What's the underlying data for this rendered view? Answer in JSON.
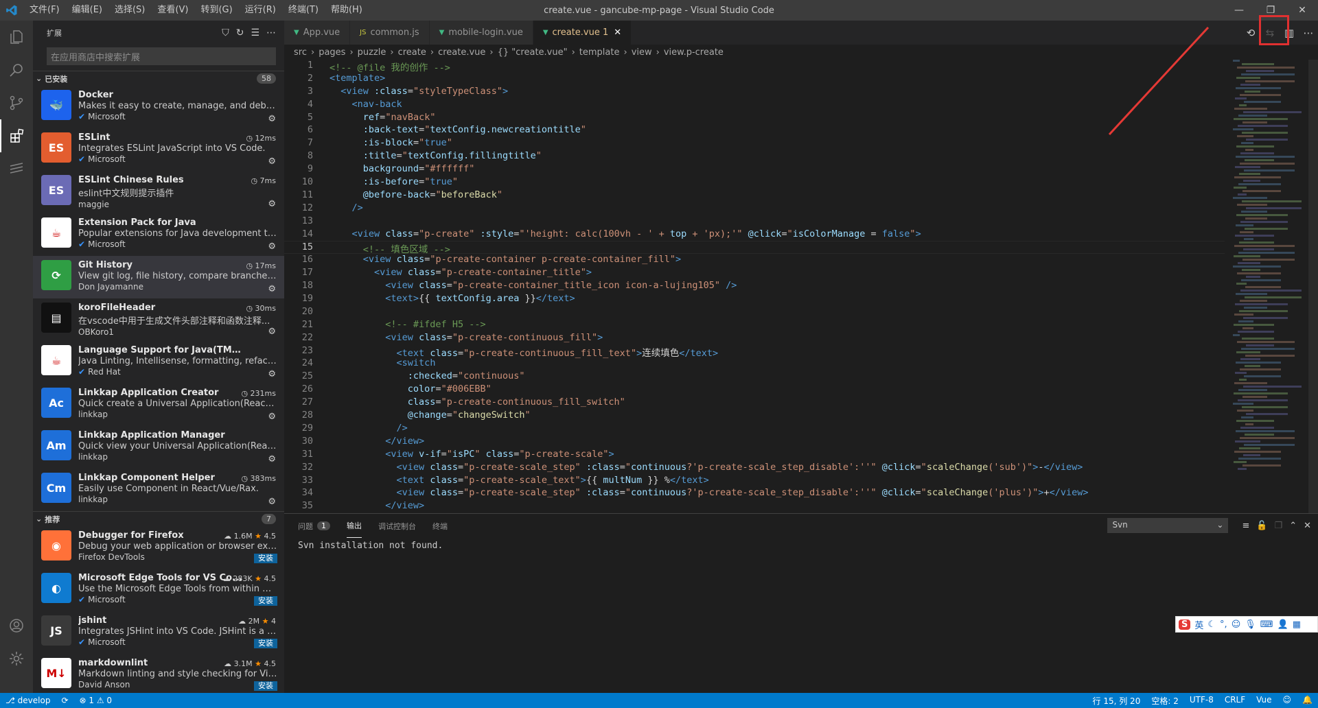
{
  "window": {
    "title": "create.vue - gancube-mp-page - Visual Studio Code",
    "menu": [
      "文件(F)",
      "编辑(E)",
      "选择(S)",
      "查看(V)",
      "转到(G)",
      "运行(R)",
      "终端(T)",
      "帮助(H)"
    ]
  },
  "sidebar": {
    "title": "扩展",
    "search_placeholder": "在应用商店中搜索扩展",
    "installed": {
      "label": "已安装",
      "count": "58",
      "items": [
        {
          "name": "Docker",
          "desc": "Makes it easy to create, manage, and debug co...",
          "publisher": "Microsoft",
          "verified": true,
          "time": "",
          "icon": "docker-icon",
          "color": "#1d63ed",
          "glyph": "🐳"
        },
        {
          "name": "ESLint",
          "desc": "Integrates ESLint JavaScript into VS Code.",
          "publisher": "Microsoft",
          "verified": true,
          "time": "12ms",
          "icon": "eslint-icon",
          "color": "#e35d2f",
          "glyph": "ES"
        },
        {
          "name": "ESLint Chinese Rules",
          "desc": "eslint中文规则提示插件",
          "publisher": "maggie",
          "verified": false,
          "time": "7ms",
          "icon": "eslint-chinese-icon",
          "color": "#6b6bb5",
          "glyph": "ES"
        },
        {
          "name": "Extension Pack for Java",
          "desc": "Popular extensions for Java development that p...",
          "publisher": "Microsoft",
          "verified": true,
          "time": "",
          "icon": "java-pack-icon",
          "color": "#ffffff",
          "glyph": "☕"
        },
        {
          "name": "Git History",
          "desc": "View git log, file history, compare branches or c...",
          "publisher": "Don Jayamanne",
          "verified": false,
          "time": "17ms",
          "icon": "git-history-icon",
          "color": "#2f9e44",
          "glyph": "⟳"
        },
        {
          "name": "koroFileHeader",
          "desc": "在vscode中用于生成文件头部注释和函数注释...",
          "publisher": "OBKoro1",
          "verified": false,
          "time": "30ms",
          "icon": "korofileheader-icon",
          "color": "#111111",
          "glyph": "▤"
        },
        {
          "name": "Language Support for Java(TM) by Red Hat",
          "desc": "Java Linting, Intellisense, formatting, refactoring...",
          "publisher": "Red Hat",
          "verified": true,
          "time": "",
          "icon": "redhat-java-icon",
          "color": "#ffffff",
          "glyph": "☕"
        },
        {
          "name": "Linkkap Application Creator",
          "desc": "Quick create a Universal Application(React/Rax/...",
          "publisher": "linkkap",
          "verified": false,
          "time": "231ms",
          "icon": "linkkap-creator-icon",
          "color": "#1e6fd9",
          "glyph": "Ac"
        },
        {
          "name": "Linkkap Application Manager",
          "desc": "Quick view your Universal Application(React/Ra...",
          "publisher": "linkkap",
          "verified": false,
          "time": "",
          "icon": "linkkap-manager-icon",
          "color": "#1e6fd9",
          "glyph": "Am"
        },
        {
          "name": "Linkkap Component Helper",
          "desc": "Easily use Component in React/Vue/Rax.",
          "publisher": "linkkap",
          "verified": false,
          "time": "383ms",
          "icon": "linkkap-helper-icon",
          "color": "#1e6fd9",
          "glyph": "Cm"
        }
      ]
    },
    "recommended": {
      "label": "推荐",
      "count": "7",
      "items": [
        {
          "name": "Debugger for Firefox",
          "desc": "Debug your web application or browser extensi...",
          "publisher": "Firefox DevTools",
          "verified": false,
          "downloads": "1.6M",
          "rating": "4.5",
          "install": "安装",
          "icon": "firefox-icon",
          "color": "#ff7139",
          "glyph": "◉"
        },
        {
          "name": "Microsoft Edge Tools for VS Co...",
          "desc": "Use the Microsoft Edge Tools from within VS C...",
          "publisher": "Microsoft",
          "verified": true,
          "downloads": "283K",
          "rating": "4.5",
          "install": "安装",
          "icon": "edge-icon",
          "color": "#0f7bd0",
          "glyph": "◐"
        },
        {
          "name": "jshint",
          "desc": "Integrates JSHint into VS Code. JSHint is a linter...",
          "publisher": "Microsoft",
          "verified": true,
          "downloads": "2M",
          "rating": "4",
          "install": "安装",
          "icon": "jshint-icon",
          "color": "#3a3a3a",
          "glyph": "JS"
        },
        {
          "name": "markdownlint",
          "desc": "Markdown linting and style checking for Visual ...",
          "publisher": "David Anson",
          "verified": false,
          "downloads": "3.1M",
          "rating": "4.5",
          "install": "安装",
          "icon": "markdownlint-icon",
          "color": "#ffffff",
          "glyph": "M↓"
        }
      ]
    }
  },
  "editor": {
    "tabs": [
      {
        "label": "App.vue",
        "icon": "vue-icon",
        "active": false
      },
      {
        "label": "common.js",
        "icon": "js-icon",
        "active": false
      },
      {
        "label": "mobile-login.vue",
        "icon": "vue-icon",
        "active": false
      },
      {
        "label": "create.vue 1",
        "icon": "vue-icon",
        "active": true
      }
    ],
    "breadcrumb": [
      "src",
      "pages",
      "puzzle",
      "create",
      "create.vue",
      "{} \"create.vue\"",
      "template",
      "view",
      "view.p-create"
    ],
    "current_line": 15,
    "lines": [
      [
        [
          "c-cm",
          "<!-- @file 我的创作 -->"
        ]
      ],
      [
        [
          "c-tag",
          "<template>"
        ]
      ],
      [
        [
          "c-txt",
          "  "
        ],
        [
          "c-tag",
          "<view "
        ],
        [
          "c-at",
          ":class"
        ],
        [
          "c-txt",
          "="
        ],
        [
          "c-str",
          "\"styleTypeClass\""
        ],
        [
          "c-tag",
          ">"
        ]
      ],
      [
        [
          "c-txt",
          "    "
        ],
        [
          "c-tag",
          "<nav-back"
        ]
      ],
      [
        [
          "c-txt",
          "      "
        ],
        [
          "c-at",
          "ref"
        ],
        [
          "c-txt",
          "="
        ],
        [
          "c-str",
          "\"navBack\""
        ]
      ],
      [
        [
          "c-txt",
          "      "
        ],
        [
          "c-at",
          ":back-text"
        ],
        [
          "c-txt",
          "="
        ],
        [
          "c-str",
          "\""
        ],
        [
          "c-at",
          "textConfig.newcreationtitle"
        ],
        [
          "c-str",
          "\""
        ]
      ],
      [
        [
          "c-txt",
          "      "
        ],
        [
          "c-at",
          ":is-block"
        ],
        [
          "c-txt",
          "="
        ],
        [
          "c-str",
          "\""
        ],
        [
          "c-tag",
          "true"
        ],
        [
          "c-str",
          "\""
        ]
      ],
      [
        [
          "c-txt",
          "      "
        ],
        [
          "c-at",
          ":title"
        ],
        [
          "c-txt",
          "="
        ],
        [
          "c-str",
          "\""
        ],
        [
          "c-at",
          "textConfig.fillingtitle"
        ],
        [
          "c-str",
          "\""
        ]
      ],
      [
        [
          "c-txt",
          "      "
        ],
        [
          "c-at",
          "background"
        ],
        [
          "c-txt",
          "="
        ],
        [
          "c-str",
          "\"#ffffff\""
        ]
      ],
      [
        [
          "c-txt",
          "      "
        ],
        [
          "c-at",
          ":is-before"
        ],
        [
          "c-txt",
          "="
        ],
        [
          "c-str",
          "\""
        ],
        [
          "c-tag",
          "true"
        ],
        [
          "c-str",
          "\""
        ]
      ],
      [
        [
          "c-txt",
          "      "
        ],
        [
          "c-at",
          "@before-back"
        ],
        [
          "c-txt",
          "="
        ],
        [
          "c-str",
          "\""
        ],
        [
          "c-b",
          "beforeBack"
        ],
        [
          "c-str",
          "\""
        ]
      ],
      [
        [
          "c-txt",
          "    "
        ],
        [
          "c-tag",
          "/>"
        ]
      ],
      [
        [
          "c-txt",
          ""
        ]
      ],
      [
        [
          "c-txt",
          "    "
        ],
        [
          "c-tag",
          "<view "
        ],
        [
          "c-at",
          "class"
        ],
        [
          "c-txt",
          "="
        ],
        [
          "c-str",
          "\"p-create\" "
        ],
        [
          "c-at",
          ":style"
        ],
        [
          "c-txt",
          "="
        ],
        [
          "c-str",
          "\"'height: calc(100vh - ' + "
        ],
        [
          "c-at",
          "top"
        ],
        [
          "c-str",
          " + 'px);'\" "
        ],
        [
          "c-at",
          "@click"
        ],
        [
          "c-txt",
          "="
        ],
        [
          "c-str",
          "\""
        ],
        [
          "c-at",
          "isColorManage"
        ],
        [
          "c-txt",
          " = "
        ],
        [
          "c-tag",
          "false"
        ],
        [
          "c-str",
          "\""
        ],
        [
          "c-tag",
          ">"
        ]
      ],
      [
        [
          "c-txt",
          "      "
        ],
        [
          "c-cm",
          "<!-- 填色区域 -->"
        ]
      ],
      [
        [
          "c-txt",
          "      "
        ],
        [
          "c-tag",
          "<view "
        ],
        [
          "c-at",
          "class"
        ],
        [
          "c-txt",
          "="
        ],
        [
          "c-str",
          "\"p-create-container p-create-container_fill\""
        ],
        [
          "c-tag",
          ">"
        ]
      ],
      [
        [
          "c-txt",
          "        "
        ],
        [
          "c-tag",
          "<view "
        ],
        [
          "c-at",
          "class"
        ],
        [
          "c-txt",
          "="
        ],
        [
          "c-str",
          "\"p-create-container_title\""
        ],
        [
          "c-tag",
          ">"
        ]
      ],
      [
        [
          "c-txt",
          "          "
        ],
        [
          "c-tag",
          "<view "
        ],
        [
          "c-at",
          "class"
        ],
        [
          "c-txt",
          "="
        ],
        [
          "c-str",
          "\"p-create-container_title_icon icon-a-lujing105\""
        ],
        [
          "c-tag",
          " />"
        ]
      ],
      [
        [
          "c-txt",
          "          "
        ],
        [
          "c-tag",
          "<text>"
        ],
        [
          "c-txt",
          "{{ "
        ],
        [
          "c-at",
          "textConfig.area"
        ],
        [
          "c-txt",
          " }}"
        ],
        [
          "c-tag",
          "</text>"
        ]
      ],
      [
        [
          "c-txt",
          ""
        ]
      ],
      [
        [
          "c-txt",
          "          "
        ],
        [
          "c-cm",
          "<!-- #ifdef H5 -->"
        ]
      ],
      [
        [
          "c-txt",
          "          "
        ],
        [
          "c-tag",
          "<view "
        ],
        [
          "c-at",
          "class"
        ],
        [
          "c-txt",
          "="
        ],
        [
          "c-str",
          "\"p-create-continuous_fill\""
        ],
        [
          "c-tag",
          ">"
        ]
      ],
      [
        [
          "c-txt",
          "            "
        ],
        [
          "c-tag",
          "<text "
        ],
        [
          "c-at",
          "class"
        ],
        [
          "c-txt",
          "="
        ],
        [
          "c-str",
          "\"p-create-continuous_fill_text\""
        ],
        [
          "c-tag",
          ">"
        ],
        [
          "c-txt",
          "连续填色"
        ],
        [
          "c-tag",
          "</text>"
        ]
      ],
      [
        [
          "c-txt",
          "            "
        ],
        [
          "c-tag",
          "<switch"
        ]
      ],
      [
        [
          "c-txt",
          "              "
        ],
        [
          "c-at",
          ":checked"
        ],
        [
          "c-txt",
          "="
        ],
        [
          "c-str",
          "\"continuous\""
        ]
      ],
      [
        [
          "c-txt",
          "              "
        ],
        [
          "c-at",
          "color"
        ],
        [
          "c-txt",
          "="
        ],
        [
          "c-str",
          "\"#006EBB\""
        ]
      ],
      [
        [
          "c-txt",
          "              "
        ],
        [
          "c-at",
          "class"
        ],
        [
          "c-txt",
          "="
        ],
        [
          "c-str",
          "\"p-create-continuous_fill_switch\""
        ]
      ],
      [
        [
          "c-txt",
          "              "
        ],
        [
          "c-at",
          "@change"
        ],
        [
          "c-txt",
          "="
        ],
        [
          "c-str",
          "\""
        ],
        [
          "c-b",
          "changeSwitch"
        ],
        [
          "c-str",
          "\""
        ]
      ],
      [
        [
          "c-txt",
          "            "
        ],
        [
          "c-tag",
          "/>"
        ]
      ],
      [
        [
          "c-txt",
          "          "
        ],
        [
          "c-tag",
          "</view>"
        ]
      ],
      [
        [
          "c-txt",
          "          "
        ],
        [
          "c-tag",
          "<view "
        ],
        [
          "c-at",
          "v-if"
        ],
        [
          "c-txt",
          "="
        ],
        [
          "c-str",
          "\""
        ],
        [
          "c-at",
          "isPC"
        ],
        [
          "c-str",
          "\" "
        ],
        [
          "c-at",
          "class"
        ],
        [
          "c-txt",
          "="
        ],
        [
          "c-str",
          "\"p-create-scale\""
        ],
        [
          "c-tag",
          ">"
        ]
      ],
      [
        [
          "c-txt",
          "            "
        ],
        [
          "c-tag",
          "<view "
        ],
        [
          "c-at",
          "class"
        ],
        [
          "c-txt",
          "="
        ],
        [
          "c-str",
          "\"p-create-scale_step\" "
        ],
        [
          "c-at",
          ":class"
        ],
        [
          "c-txt",
          "="
        ],
        [
          "c-str",
          "\""
        ],
        [
          "c-at",
          "continuous"
        ],
        [
          "c-str",
          "?'p-create-scale_step_disable':''\" "
        ],
        [
          "c-at",
          "@click"
        ],
        [
          "c-txt",
          "="
        ],
        [
          "c-str",
          "\""
        ],
        [
          "c-b",
          "scaleChange"
        ],
        [
          "c-str",
          "('sub')\""
        ],
        [
          "c-tag",
          ">"
        ],
        [
          "c-txt",
          "-"
        ],
        [
          "c-tag",
          "</view>"
        ]
      ],
      [
        [
          "c-txt",
          "            "
        ],
        [
          "c-tag",
          "<text "
        ],
        [
          "c-at",
          "class"
        ],
        [
          "c-txt",
          "="
        ],
        [
          "c-str",
          "\"p-create-scale_text\""
        ],
        [
          "c-tag",
          ">"
        ],
        [
          "c-txt",
          "{{ "
        ],
        [
          "c-at",
          "multNum"
        ],
        [
          "c-txt",
          " }} %"
        ],
        [
          "c-tag",
          "</text>"
        ]
      ],
      [
        [
          "c-txt",
          "            "
        ],
        [
          "c-tag",
          "<view "
        ],
        [
          "c-at",
          "class"
        ],
        [
          "c-txt",
          "="
        ],
        [
          "c-str",
          "\"p-create-scale_step\" "
        ],
        [
          "c-at",
          ":class"
        ],
        [
          "c-txt",
          "="
        ],
        [
          "c-str",
          "\""
        ],
        [
          "c-at",
          "continuous"
        ],
        [
          "c-str",
          "?'p-create-scale_step_disable':''\" "
        ],
        [
          "c-at",
          "@click"
        ],
        [
          "c-txt",
          "="
        ],
        [
          "c-str",
          "\""
        ],
        [
          "c-b",
          "scaleChange"
        ],
        [
          "c-str",
          "('plus')\""
        ],
        [
          "c-tag",
          ">"
        ],
        [
          "c-txt",
          "+"
        ],
        [
          "c-tag",
          "</view>"
        ]
      ],
      [
        [
          "c-txt",
          "          "
        ],
        [
          "c-tag",
          "</view>"
        ]
      ]
    ]
  },
  "panel": {
    "tabs": [
      {
        "label": "问题",
        "badge": "1",
        "active": false
      },
      {
        "label": "输出",
        "badge": "",
        "active": true
      },
      {
        "label": "调试控制台",
        "badge": "",
        "active": false
      },
      {
        "label": "终端",
        "badge": "",
        "active": false
      }
    ],
    "output_channel": "Svn",
    "output_text": "Svn installation not found."
  },
  "ime": {
    "logo": "S",
    "lang": "英"
  },
  "status": {
    "branch": "develop",
    "problems": "⊗ 1 ⚠ 0",
    "position": "行 15, 列 20",
    "spaces": "空格: 2",
    "encoding": "UTF-8",
    "eol": "CRLF",
    "language": "Vue"
  },
  "colors": {
    "accent": "#007acc",
    "highlight_box": "#e03030"
  }
}
